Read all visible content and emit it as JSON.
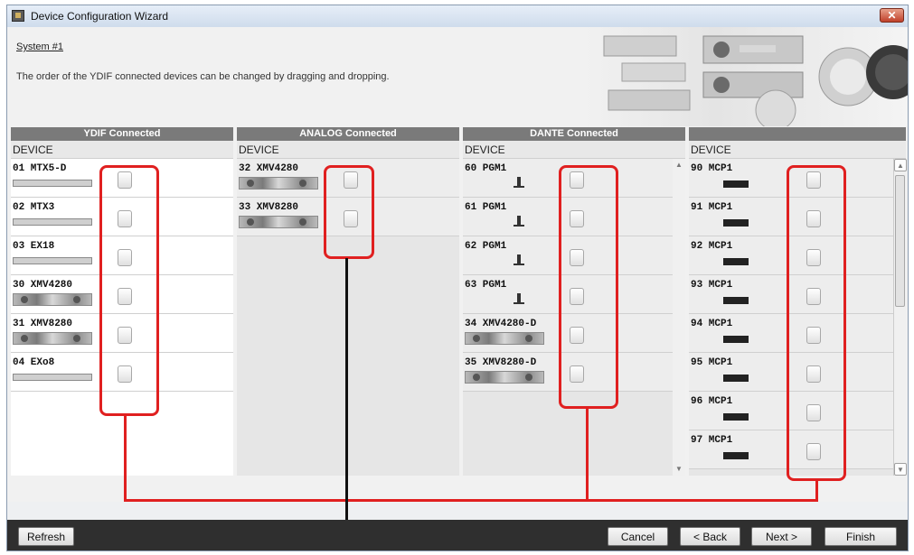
{
  "window": {
    "title": "Device Configuration Wizard",
    "close_icon": "close-icon"
  },
  "header": {
    "system_title": "System #1",
    "description": "The order of the YDIF connected devices can be changed by dragging and dropping."
  },
  "panels": [
    {
      "title": "YDIF Connected",
      "column": "DEVICE",
      "devices": [
        {
          "label": "01 MTX5-D",
          "icon": "mtx-unit-icon"
        },
        {
          "label": "02 MTX3",
          "icon": "mtx-unit-icon"
        },
        {
          "label": "03 EX18",
          "icon": "ex-unit-icon"
        },
        {
          "label": "30 XMV4280",
          "icon": "xmv-amp-icon"
        },
        {
          "label": "31 XMV8280",
          "icon": "xmv-amp-icon"
        },
        {
          "label": "04 EXo8",
          "icon": "ex-unit-icon"
        }
      ]
    },
    {
      "title": "ANALOG Connected",
      "column": "DEVICE",
      "devices": [
        {
          "label": "32 XMV4280",
          "icon": "xmv-amp-icon"
        },
        {
          "label": "33 XMV8280",
          "icon": "xmv-amp-icon"
        }
      ]
    },
    {
      "title": "DANTE Connected",
      "column": "DEVICE",
      "devices": [
        {
          "label": "60 PGM1",
          "icon": "paging-mic-icon"
        },
        {
          "label": "61 PGM1",
          "icon": "paging-mic-icon"
        },
        {
          "label": "62 PGM1",
          "icon": "paging-mic-icon"
        },
        {
          "label": "63 PGM1",
          "icon": "paging-mic-icon"
        },
        {
          "label": "34 XMV4280-D",
          "icon": "xmv-amp-icon"
        },
        {
          "label": "35 XMV8280-D",
          "icon": "xmv-amp-icon"
        }
      ]
    },
    {
      "title": "",
      "column": "DEVICE",
      "devices": [
        {
          "label": "90 MCP1",
          "icon": "mcp-panel-icon"
        },
        {
          "label": "91 MCP1",
          "icon": "mcp-panel-icon"
        },
        {
          "label": "92 MCP1",
          "icon": "mcp-panel-icon"
        },
        {
          "label": "93 MCP1",
          "icon": "mcp-panel-icon"
        },
        {
          "label": "94 MCP1",
          "icon": "mcp-panel-icon"
        },
        {
          "label": "95 MCP1",
          "icon": "mcp-panel-icon"
        },
        {
          "label": "96 MCP1",
          "icon": "mcp-panel-icon"
        },
        {
          "label": "97 MCP1",
          "icon": "mcp-panel-icon"
        }
      ]
    }
  ],
  "footer": {
    "refresh": "Refresh",
    "cancel": "Cancel",
    "back": "< Back",
    "next": "Next >",
    "finish": "Finish"
  },
  "colors": {
    "highlight": "#e02020",
    "panel_header": "#7a7a7a",
    "footer": "#2f2f2f"
  }
}
